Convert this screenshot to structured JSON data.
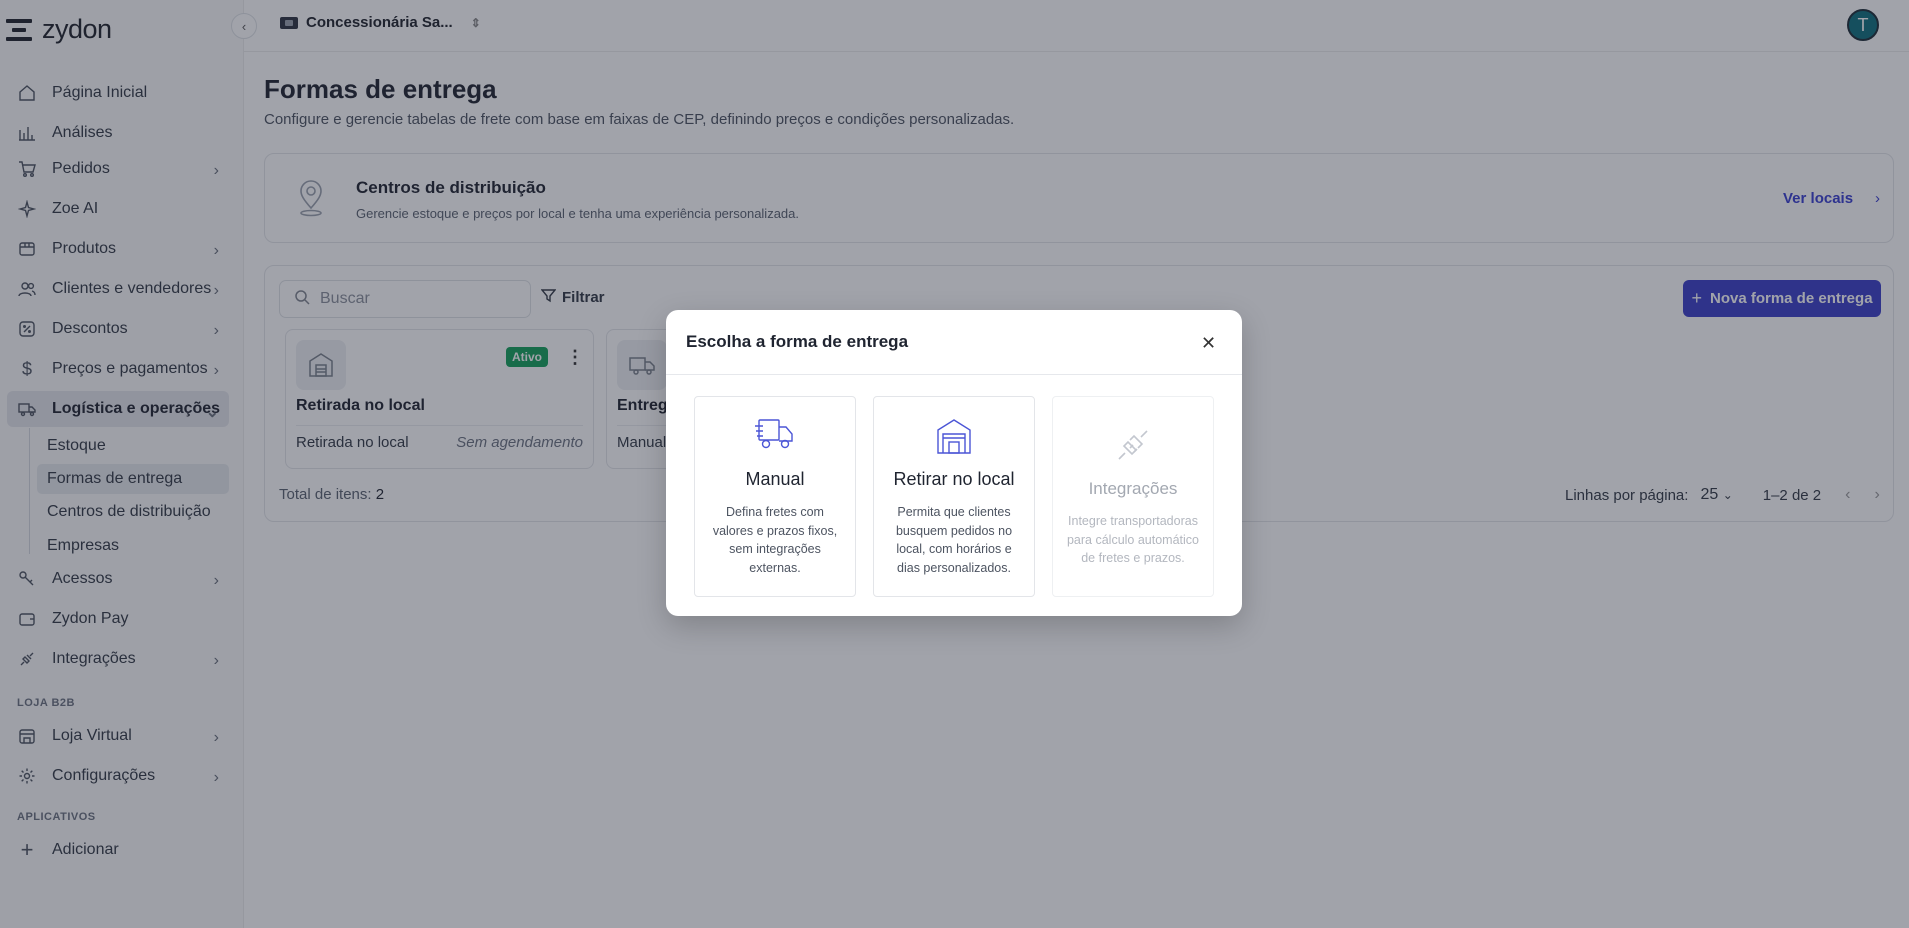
{
  "brand": {
    "name": "zydon"
  },
  "topbar": {
    "store_name": "Concessionária Sa...",
    "avatar_initial": "T"
  },
  "sidebar": {
    "items": [
      {
        "label": "Página Inicial",
        "icon": "home-icon"
      },
      {
        "label": "Análises",
        "icon": "chart-icon"
      },
      {
        "label": "Pedidos",
        "icon": "cart-icon"
      },
      {
        "label": "Zoe AI",
        "icon": "sparkle-icon"
      },
      {
        "label": "Produtos",
        "icon": "box-icon"
      },
      {
        "label": "Clientes e vendedores",
        "icon": "users-icon"
      },
      {
        "label": "Descontos",
        "icon": "discount-icon"
      },
      {
        "label": "Preços e pagamentos",
        "icon": "dollar-icon"
      },
      {
        "label": "Logística e operações",
        "icon": "truck-icon"
      },
      {
        "label": "Acessos",
        "icon": "key-icon"
      },
      {
        "label": "Zydon Pay",
        "icon": "wallet-icon"
      },
      {
        "label": "Integrações",
        "icon": "plug-icon"
      },
      {
        "label": "Loja Virtual",
        "icon": "store-icon"
      },
      {
        "label": "Configurações",
        "icon": "gear-icon"
      },
      {
        "label": "Adicionar",
        "icon": "plus-icon"
      }
    ],
    "logistics_sub": [
      "Estoque",
      "Formas de entrega",
      "Centros de distribuição",
      "Empresas"
    ],
    "section_b2b": "LOJA B2B",
    "section_apps": "APLICATIVOS"
  },
  "page": {
    "title": "Formas de entrega",
    "subtitle": "Configure e gerencie tabelas de frete com base em faixas de CEP, definindo preços e condições personalizadas."
  },
  "distribution_card": {
    "title": "Centros de distribuição",
    "description": "Gerencie estoque e preços por local e tenha uma experiência personalizada.",
    "link": "Ver locais"
  },
  "toolbar": {
    "search_placeholder": "Buscar",
    "filter_label": "Filtrar",
    "new_button": "Nova forma de entrega"
  },
  "cards": [
    {
      "title": "Retirada no local",
      "type": "Retirada no local",
      "schedule": "Sem agendamento",
      "badge": "Ativo"
    },
    {
      "title": "Entrega",
      "type": "Manual"
    }
  ],
  "footer": {
    "total_label": "Total de itens:",
    "total_value": "2",
    "rows_label": "Linhas por página:",
    "rows_value": "25",
    "range": "1–2 de 2"
  },
  "modal": {
    "title": "Escolha a forma de entrega",
    "options": [
      {
        "title": "Manual",
        "description": "Defina fretes com valores e prazos fixos, sem integrações externas.",
        "icon": "truck-icon",
        "enabled": true
      },
      {
        "title": "Retirar no local",
        "description": "Permita que clientes busquem pedidos no local, com horários e dias personalizados.",
        "icon": "warehouse-icon",
        "enabled": true
      },
      {
        "title": "Integrações",
        "description": "Integre transportadoras para cálculo automático de fretes e prazos.",
        "icon": "plug-icon",
        "enabled": false
      }
    ]
  }
}
